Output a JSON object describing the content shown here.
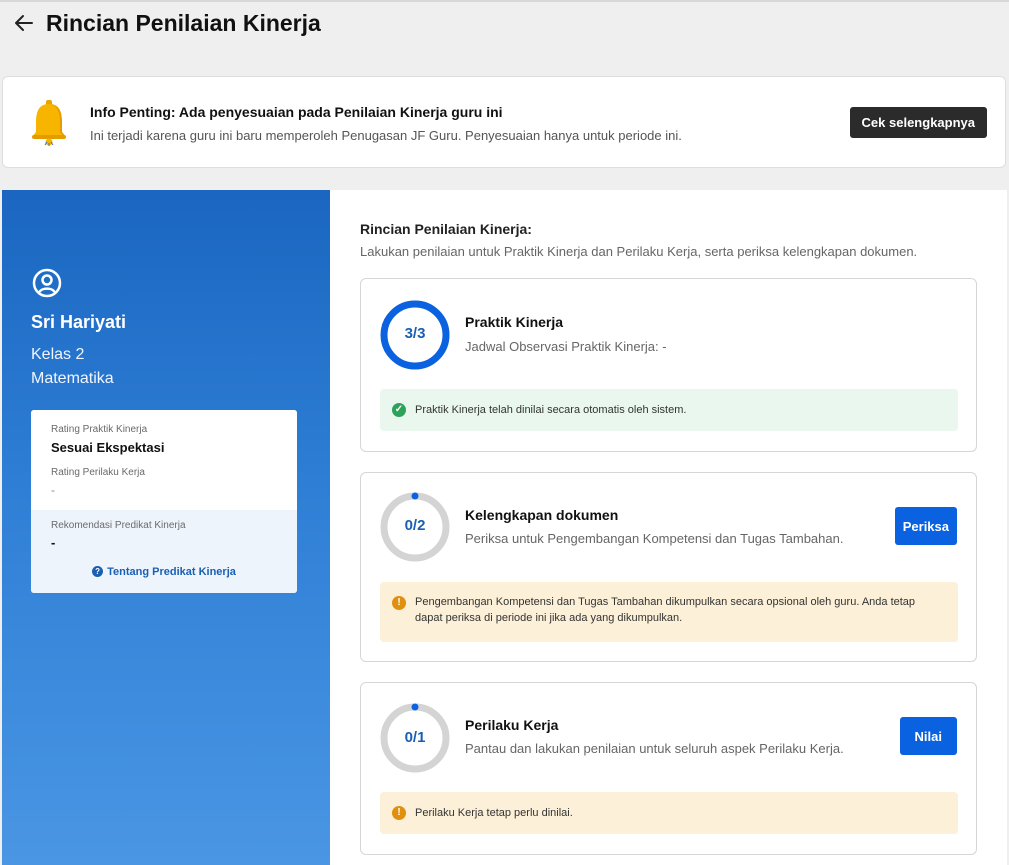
{
  "header": {
    "title": "Rincian Penilaian Kinerja"
  },
  "info": {
    "title": "Info Penting: Ada penyesuaian pada Penilaian Kinerja guru ini",
    "text": "Ini terjadi karena guru ini baru memperoleh Penugasan JF Guru. Penyesuaian hanya untuk periode ini.",
    "button_label": "Cek selengkapnya"
  },
  "teacher": {
    "name": "Sri Hariyati",
    "class": "Kelas 2",
    "subject": "Matematika"
  },
  "rating_card": {
    "praktik_label": "Rating Praktik Kinerja",
    "praktik_value": "Sesuai Ekspektasi",
    "perilaku_label": "Rating Perilaku Kerja",
    "perilaku_value": "-",
    "rekomendasi_label": "Rekomendasi Predikat Kinerja",
    "rekomendasi_value": "-",
    "link_label": "Tentang Predikat Kinerja"
  },
  "details": {
    "title": "Rincian Penilaian Kinerja:",
    "subtitle": "Lakukan penilaian untuk Praktik Kinerja dan Perilaku Kerja, serta periksa kelengkapan dokumen."
  },
  "sections": [
    {
      "progress_label": "3/3",
      "done": 3,
      "total": 3,
      "title": "Praktik Kinerja",
      "subtitle": "Jadwal Observasi Praktik Kinerja: -",
      "alert_text": "Praktik Kinerja telah dinilai secara otomatis oleh sistem.",
      "alert_type": "success"
    },
    {
      "progress_label": "0/2",
      "done": 0,
      "total": 2,
      "title": "Kelengkapan dokumen",
      "subtitle": "Periksa untuk Pengembangan Kompetensi dan Tugas Tambahan.",
      "button_label": "Periksa",
      "alert_text": "Pengembangan Kompetensi dan Tugas Tambahan dikumpulkan secara opsional oleh guru. Anda tetap dapat periksa di periode ini jika ada yang dikumpulkan.",
      "alert_type": "warning"
    },
    {
      "progress_label": "0/1",
      "done": 0,
      "total": 1,
      "title": "Perilaku Kerja",
      "subtitle": "Pantau dan lakukan penilaian untuk seluruh aspek Perilaku Kerja.",
      "button_label": "Nilai",
      "alert_text": "Perilaku Kerja tetap perlu dinilai.",
      "alert_type": "warning"
    }
  ],
  "colors": {
    "accent": "#0b62e0",
    "ring_track": "#d4d4d4",
    "ring_fill": "#0b62e0",
    "success_bg": "#e9f7ee",
    "warning_bg": "#fdf0d8",
    "panel_blue": "#1a66c0"
  }
}
